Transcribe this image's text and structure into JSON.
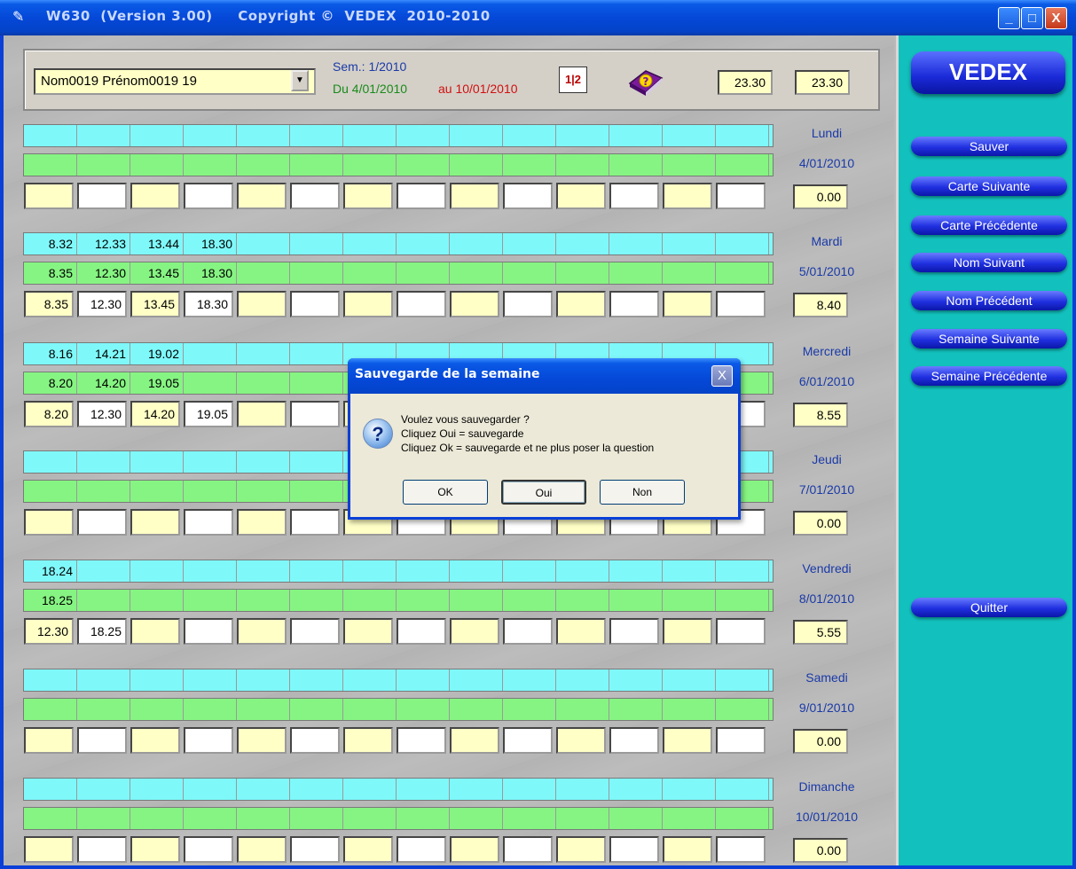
{
  "window": {
    "title": "W630  (Version 3.00)     Copyright ©  VEDEX  2010-2010",
    "minimize_label": "_",
    "maximize_label": "□",
    "close_label": "X"
  },
  "header": {
    "employee": "Nom0019 Prénom0019 19",
    "combo_arrow": "▼",
    "sem": "Sem.: 1/2010",
    "du": "Du  4/01/2010",
    "au": "au 10/01/2010",
    "calendar_icon_text": "1|2",
    "total_1": "23.30",
    "total_2": "23.30"
  },
  "days": [
    {
      "name": "Lundi",
      "date": "4/01/2010",
      "total": "0.00",
      "cyan": [],
      "green": [],
      "input": []
    },
    {
      "name": "Mardi",
      "date": "5/01/2010",
      "total": "8.40",
      "cyan": [
        "8.32",
        "12.33",
        "13.44",
        "18.30"
      ],
      "green": [
        "8.35",
        "12.30",
        "13.45",
        "18.30"
      ],
      "input": [
        "8.35",
        "12.30",
        "13.45",
        "18.30"
      ]
    },
    {
      "name": "Mercredi",
      "date": "6/01/2010",
      "total": "8.55",
      "cyan": [
        "8.16",
        "14.21",
        "19.02"
      ],
      "green": [
        "8.20",
        "14.20",
        "19.05"
      ],
      "input": [
        "8.20",
        "12.30",
        "14.20",
        "19.05"
      ]
    },
    {
      "name": "Jeudi",
      "date": "7/01/2010",
      "total": "0.00",
      "cyan": [],
      "green": [],
      "input": []
    },
    {
      "name": "Vendredi",
      "date": "8/01/2010",
      "total": "5.55",
      "cyan": [
        "18.24"
      ],
      "green": [
        "18.25"
      ],
      "input": [
        "12.30",
        "18.25"
      ]
    },
    {
      "name": "Samedi",
      "date": "9/01/2010",
      "total": "0.00",
      "cyan": [],
      "green": [],
      "input": []
    },
    {
      "name": "Dimanche",
      "date": "10/01/2010",
      "total": "0.00",
      "cyan": [],
      "green": [],
      "input": []
    }
  ],
  "sidebar": {
    "logo": "VEDEX",
    "buttons": [
      "Sauver",
      "Carte Suivante",
      "Carte Précédente",
      "Nom Suivant",
      "Nom Précédent",
      "Semaine Suivante",
      "Semaine Précédente"
    ],
    "quit": "Quitter"
  },
  "dialog": {
    "title": "Sauvegarde de la semaine",
    "close_label": "X",
    "icon_text": "?",
    "lines": [
      "Voulez vous sauvegarder ?",
      "Cliquez Oui = sauvegarde",
      "Cliquez Ok = sauvegarde et ne plus poser la question"
    ],
    "ok": "OK",
    "oui": "Oui",
    "non": "Non"
  },
  "colors": {
    "accent": "#0a3fd8",
    "sidebar": "#12c0bd",
    "cyan_row": "#7ff8fa",
    "green_row": "#86f482",
    "input_yellow": "#ffffc6"
  }
}
